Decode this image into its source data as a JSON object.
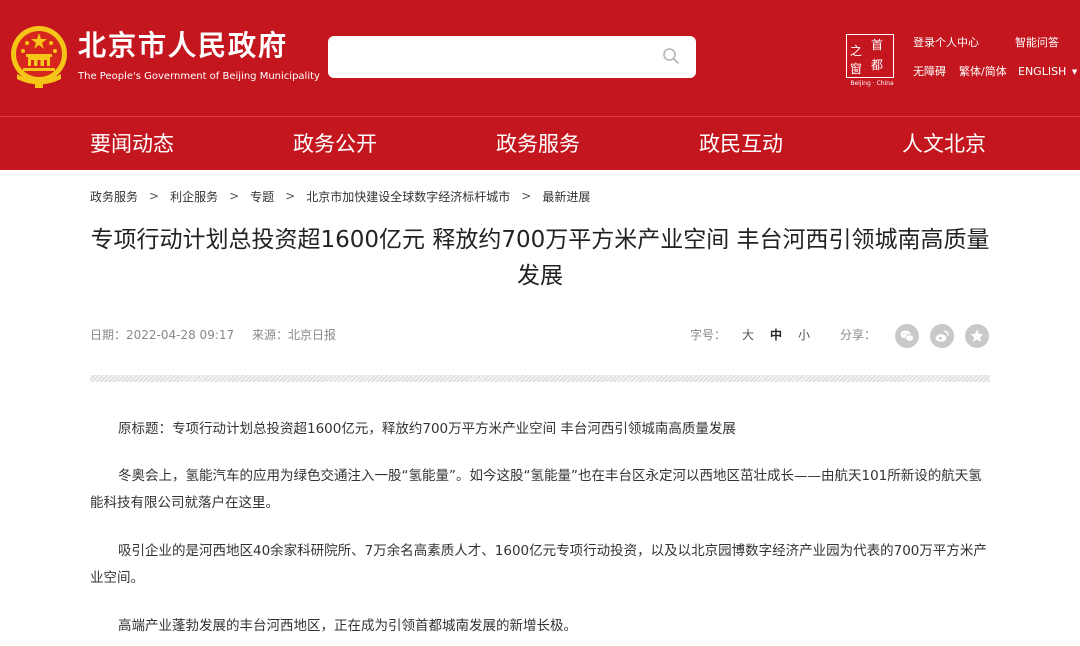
{
  "header": {
    "site_name": "北京市人民政府",
    "site_name_en": "The People's Government of Beijing Municipality",
    "search": {
      "placeholder": "",
      "value": ""
    },
    "capital_logo": {
      "chars": [
        "首",
        "之",
        "都",
        "窗"
      ],
      "subtitle": "Beijing · China"
    },
    "top_links": {
      "login": "登录个人中心",
      "smart_qa": "智能问答",
      "accessibility": "无障碍",
      "language_switch": "繁体/简体",
      "english": "ENGLISH"
    }
  },
  "nav": {
    "items": [
      "要闻动态",
      "政务公开",
      "政务服务",
      "政民互动",
      "人文北京"
    ]
  },
  "breadcrumb": [
    "政务服务",
    "利企服务",
    "专题",
    "北京市加快建设全球数字经济标杆城市",
    "最新进展"
  ],
  "breadcrumb_sep": ">",
  "article": {
    "title": "专项行动计划总投资超1600亿元 释放约700万平方米产业空间 丰台河西引领城南高质量发展",
    "date": "日期：2022-04-28 09:17",
    "source": "来源：北京日报",
    "font_size": {
      "label": "字号：",
      "options": [
        "大",
        "中",
        "小"
      ],
      "selected": "中"
    },
    "share_label": "分享：",
    "share_icons": [
      "wechat-icon",
      "weibo-icon",
      "favorite-icon"
    ],
    "paragraphs": [
      "原标题：专项行动计划总投资超1600亿元，释放约700万平方米产业空间 丰台河西引领城南高质量发展",
      "冬奥会上，氢能汽车的应用为绿色交通注入一股“氢能量”。如今这股“氢能量”也在丰台区永定河以西地区茁壮成长——由航天101所新设的航天氢能科技有限公司就落户在这里。",
      "吸引企业的是河西地区40余家科研院所、7万余名高素质人才、1600亿元专项行动投资，以及以北京园博数字经济产业园为代表的700万平方米产业空间。",
      "高端产业蓬勃发展的丰台河西地区，正在成为引领首都城南发展的新增长极。"
    ]
  },
  "colors": {
    "brand_red": "#c4161e",
    "emblem_gold": "#f5c518",
    "text": "#333333",
    "meta": "#888888"
  }
}
